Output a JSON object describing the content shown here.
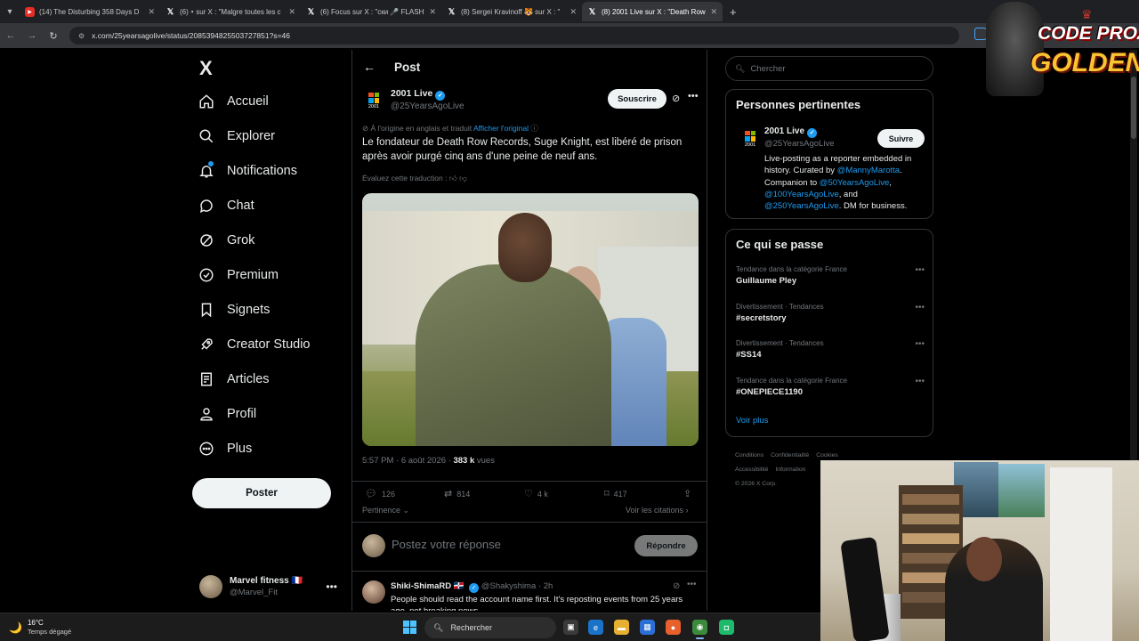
{
  "browser": {
    "tabs": [
      {
        "title": "(14) The Disturbing 358 Days D",
        "icon": "youtube-icon",
        "active": false
      },
      {
        "title": "(6) ⁍ sur X : \"Malgre toutes les c",
        "icon": "x-icon",
        "active": false
      },
      {
        "title": "(6) Focus sur X : \"ски 🎤 FLASH",
        "icon": "x-icon",
        "active": false
      },
      {
        "title": "(8) Sergei Kravinoff 🐯 sur X : \"",
        "icon": "x-icon",
        "active": false
      },
      {
        "title": "(8) 2001 Live sur X : \"Death Row",
        "icon": "x-icon",
        "active": true
      }
    ],
    "new_tab": "+",
    "url": "x.com/25yearsagolive/status/2085394825503727851?s=46"
  },
  "sidebar": {
    "logo": "X",
    "items": [
      {
        "label": "Accueil",
        "icon": "home-icon"
      },
      {
        "label": "Explorer",
        "icon": "search-icon"
      },
      {
        "label": "Notifications",
        "icon": "bell-icon"
      },
      {
        "label": "Chat",
        "icon": "chat-icon"
      },
      {
        "label": "Grok",
        "icon": "grok-icon"
      },
      {
        "label": "Premium",
        "icon": "premium-icon"
      },
      {
        "label": "Signets",
        "icon": "bookmark-icon"
      },
      {
        "label": "Creator Studio",
        "icon": "rocket-icon"
      },
      {
        "label": "Articles",
        "icon": "article-icon"
      },
      {
        "label": "Profil",
        "icon": "person-icon"
      },
      {
        "label": "Plus",
        "icon": "more-circle-icon"
      }
    ],
    "post_button": "Poster",
    "account": {
      "name": "Marvel fitness 🇫🇷",
      "handle": "@Marvel_Fit"
    }
  },
  "main": {
    "header_title": "Post",
    "author": {
      "name": "2001 Live",
      "handle": "@25YearsAgoLive",
      "logo_year": "2001"
    },
    "subscribe_label": "Souscrire",
    "translation_note": "À l'origine en anglais et traduit",
    "translation_link": "Afficher l'original",
    "tweet_text": "Le fondateur de Death Row Records, Suge Knight, est libéré de prison après avoir purgé cinq ans d'une peine de neuf ans.",
    "rate_translation": "Évaluez cette traduction :",
    "time": "5:57 PM · 6 août 2026 · ",
    "views_count": "383 k",
    "views_label": " vues",
    "stats": {
      "replies": "126",
      "reposts": "814",
      "likes": "4 k",
      "bookmarks": "417"
    },
    "sort_label": "Pertinence",
    "quotes_link": "Voir les citations",
    "reply_placeholder": "Postez votre réponse",
    "reply_button": "Répondre",
    "comment": {
      "name": "Shiki-ShimaRD 🇩🇴",
      "handle": "@Shakyshima · 2h",
      "text": "People should read the account name first. It's reposting events from 25 years ago, not breaking news."
    }
  },
  "right": {
    "search_placeholder": "Chercher",
    "relevant": {
      "title": "Personnes pertinentes",
      "name": "2001 Live",
      "handle": "@25YearsAgoLive",
      "follow": "Suivre",
      "bio_1": "Live-posting as a reporter embedded in history. Curated by ",
      "bio_m1": "@MannyMarotta",
      "bio_2": ". Companion to ",
      "bio_m2": "@50YearsAgoLive",
      "bio_3": ", ",
      "bio_m3": "@100YearsAgoLive",
      "bio_4": ", and ",
      "bio_m4": "@250YearsAgoLive",
      "bio_5": ". DM for business."
    },
    "trends": {
      "title": "Ce qui se passe",
      "items": [
        {
          "context": "Tendance dans la catégorie France",
          "title": "Guillaume Pley"
        },
        {
          "context": "Divertissement · Tendances",
          "title": "#secretstory"
        },
        {
          "context": "Divertissement · Tendances",
          "title": "#SS14"
        },
        {
          "context": "Tendance dans la catégorie France",
          "title": "#ONEPIECE1190"
        }
      ],
      "more": "Voir plus"
    },
    "footer": {
      "links": [
        "Conditions",
        "Confidentialité",
        "Cookies",
        "Accessibilité",
        "Information"
      ],
      "copyright": "© 2026 X Corp."
    }
  },
  "overlay": {
    "brand_line1": "CODE PROZIS",
    "brand_line2": "GOLDENG"
  },
  "taskbar": {
    "temp": "16°C",
    "weather": "Temps dégagé",
    "search": "Rechercher"
  },
  "colors": {
    "accent": "#1d9bf0",
    "background": "#000000",
    "muted": "#71767b"
  }
}
